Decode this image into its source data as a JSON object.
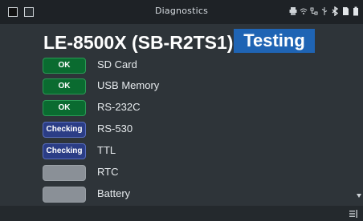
{
  "statusbar": {
    "title": "Diagnostics",
    "icons": [
      "printer-icon",
      "wifi-icon",
      "network-icon",
      "usb-icon",
      "bluetooth-icon",
      "sd-card-icon",
      "battery-icon"
    ]
  },
  "header": {
    "model": "LE-8500X (SB-R2TS1)",
    "state": "Testing"
  },
  "items": [
    {
      "status": "OK",
      "state": "ok",
      "label": "SD Card"
    },
    {
      "status": "OK",
      "state": "ok",
      "label": "USB Memory"
    },
    {
      "status": "OK",
      "state": "ok",
      "label": "RS-232C"
    },
    {
      "status": "Checking",
      "state": "checking",
      "label": "RS-530"
    },
    {
      "status": "Checking",
      "state": "checking",
      "label": "TTL"
    },
    {
      "status": "",
      "state": "pending",
      "label": "RTC"
    },
    {
      "status": "",
      "state": "pending",
      "label": "Battery"
    }
  ],
  "colors": {
    "ok": "#0a6b30",
    "checking": "#2b3d86",
    "pending": "#8a9097",
    "testing_badge": "#1f64b4",
    "background": "#2e3439"
  }
}
